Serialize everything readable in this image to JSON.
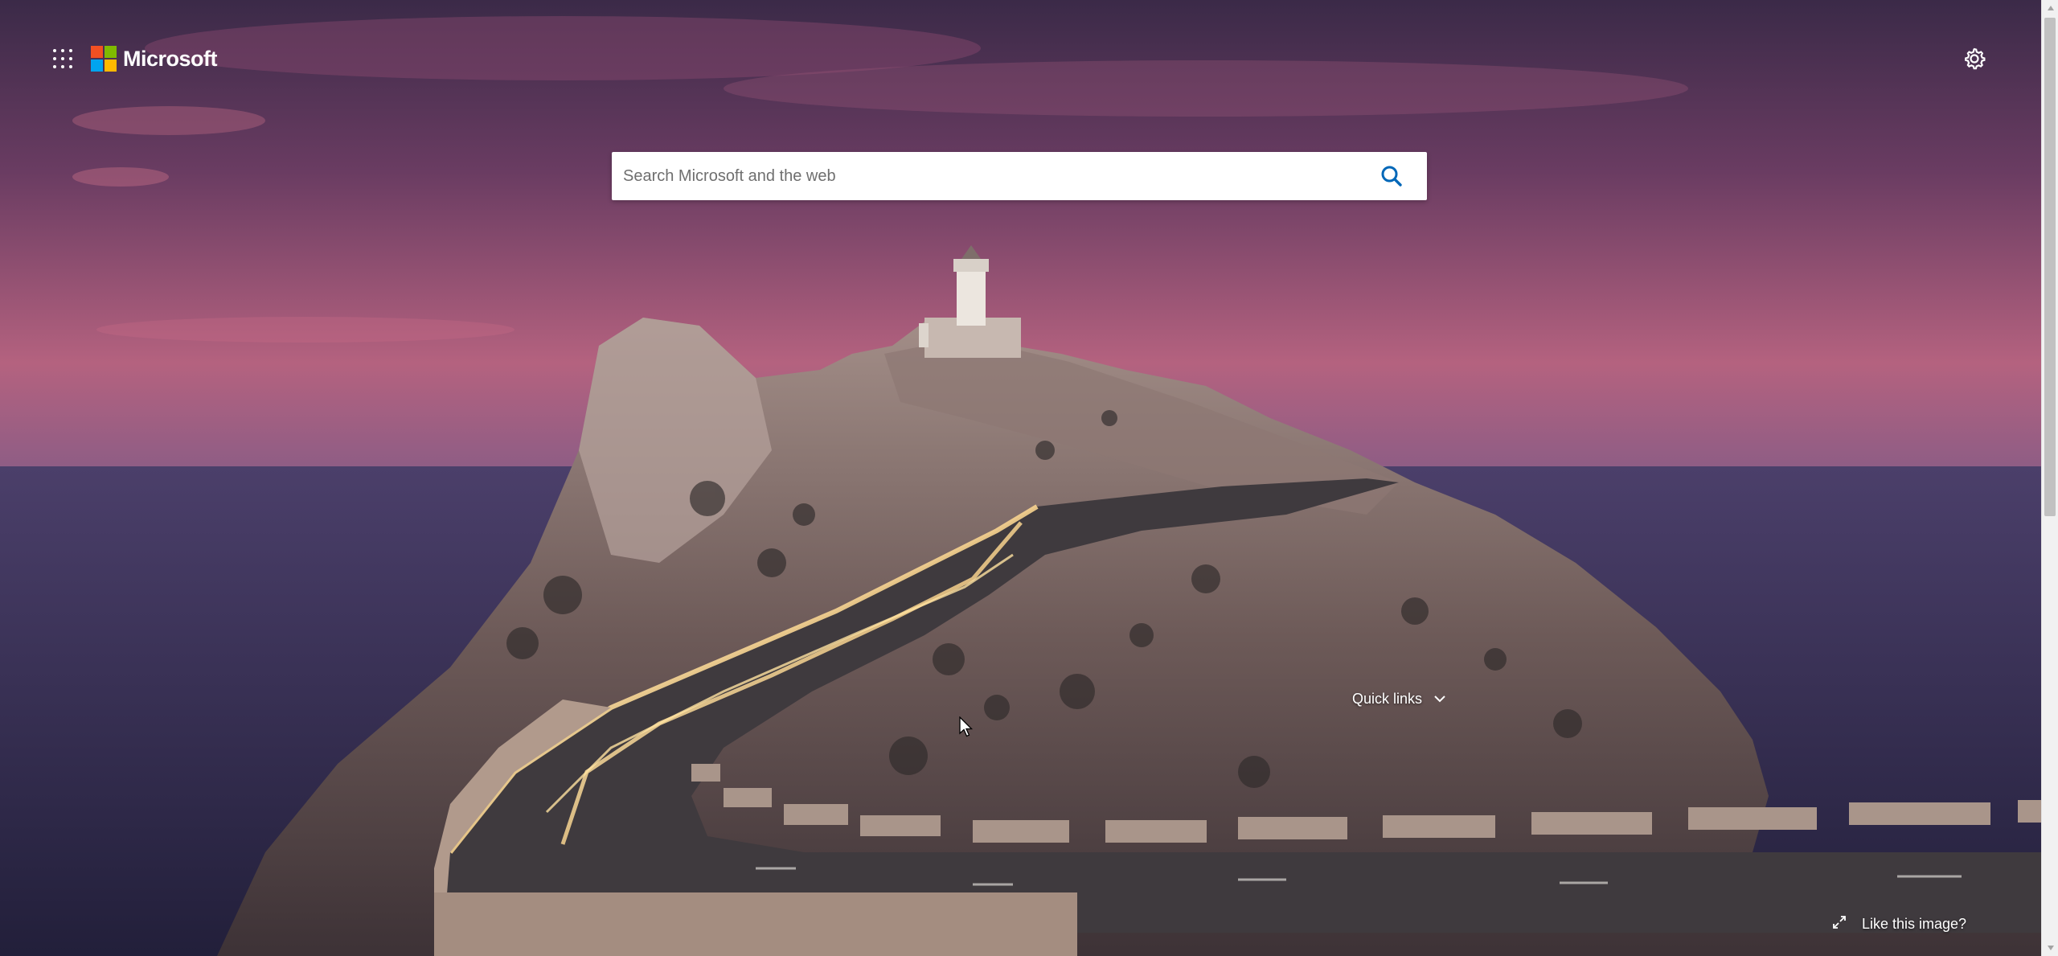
{
  "header": {
    "brand_name": "Microsoft",
    "apps_icon": "waffle-grid-icon",
    "settings_icon": "gear-icon"
  },
  "search": {
    "placeholder": "Search Microsoft and the web",
    "value": "",
    "search_icon": "magnifier-icon"
  },
  "quick_links": {
    "label": "Quick links",
    "icon": "chevron-down-icon"
  },
  "background_credit": {
    "label": "Like this image?",
    "icon": "expand-icon"
  },
  "colors": {
    "logo_red": "#f25022",
    "logo_green": "#7fba00",
    "logo_blue": "#00a4ef",
    "logo_yellow": "#ffb900",
    "search_icon": "#0067b8",
    "text_on_image": "#ffffff"
  }
}
